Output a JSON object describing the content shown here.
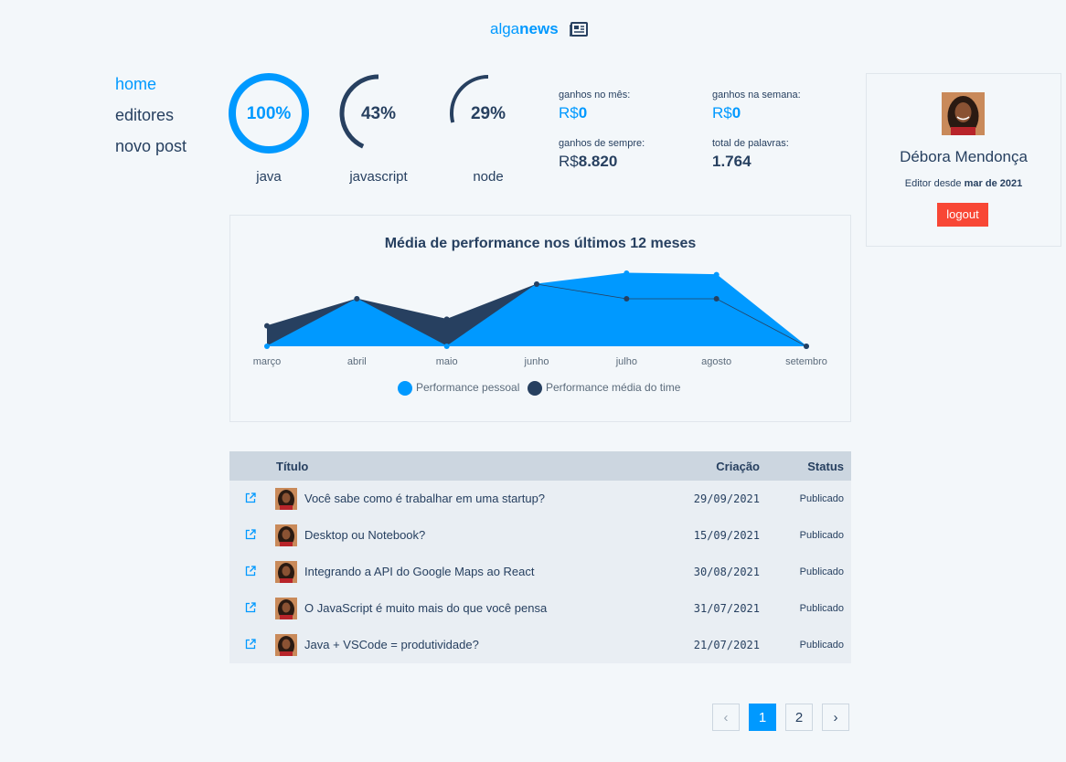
{
  "header": {
    "logo_part1": "alga",
    "logo_part2": "news",
    "logo_icon": "newspaper-icon"
  },
  "nav": {
    "items": [
      "home",
      "editores",
      "novo post"
    ],
    "active": "home"
  },
  "skills": [
    {
      "percent": "100%",
      "value": 100,
      "name": "java"
    },
    {
      "percent": "43%",
      "value": 43,
      "name": "javascript"
    },
    {
      "percent": "29%",
      "value": 29,
      "name": "node"
    }
  ],
  "earnings": {
    "month_label": "ganhos no mês:",
    "month_currency": "R$",
    "month_value": "0",
    "week_label": "ganhos na semana:",
    "week_currency": "R$",
    "week_value": "0",
    "all_label": "ganhos de sempre:",
    "all_currency": "R$",
    "all_value": "8.820",
    "words_label": "total de palavras:",
    "words_value": "1.764"
  },
  "profile": {
    "name": "Débora Mendonça",
    "since_prefix": "Editor desde",
    "since_date": "mar de 2021",
    "logout_label": "logout"
  },
  "chart_data": {
    "type": "area",
    "title": "Média de performance nos últimos 12 meses",
    "categories": [
      "março",
      "abril",
      "maio",
      "junho",
      "julho",
      "agosto",
      "setembro"
    ],
    "ylim": [
      0,
      100
    ],
    "series": [
      {
        "name": "Performance pessoal",
        "color": "#0099ff",
        "values": [
          0,
          65,
          0,
          85,
          100,
          98,
          0
        ]
      },
      {
        "name": "Performance média do time",
        "color": "#274060",
        "values": [
          28,
          65,
          37,
          85,
          65,
          65,
          0
        ]
      }
    ],
    "legend": "bottom"
  },
  "table": {
    "headers": {
      "title": "Título",
      "created": "Criação",
      "status": "Status"
    },
    "rows": [
      {
        "title": "Você sabe como é trabalhar em uma startup?",
        "date": "29/09/2021",
        "status": "Publicado"
      },
      {
        "title": "Desktop ou Notebook?",
        "date": "15/09/2021",
        "status": "Publicado"
      },
      {
        "title": "Integrando a API do Google Maps ao React",
        "date": "30/08/2021",
        "status": "Publicado"
      },
      {
        "title": "O JavaScript é muito mais do que você pensa",
        "date": "31/07/2021",
        "status": "Publicado"
      },
      {
        "title": "Java + VSCode = produtividade?",
        "date": "21/07/2021",
        "status": "Publicado"
      }
    ]
  },
  "pagination": {
    "prev": "‹",
    "pages": [
      "1",
      "2"
    ],
    "current": "1",
    "next": "›"
  },
  "colors": {
    "accent": "#0099ff",
    "primary": "#274060",
    "danger": "#f84735"
  }
}
